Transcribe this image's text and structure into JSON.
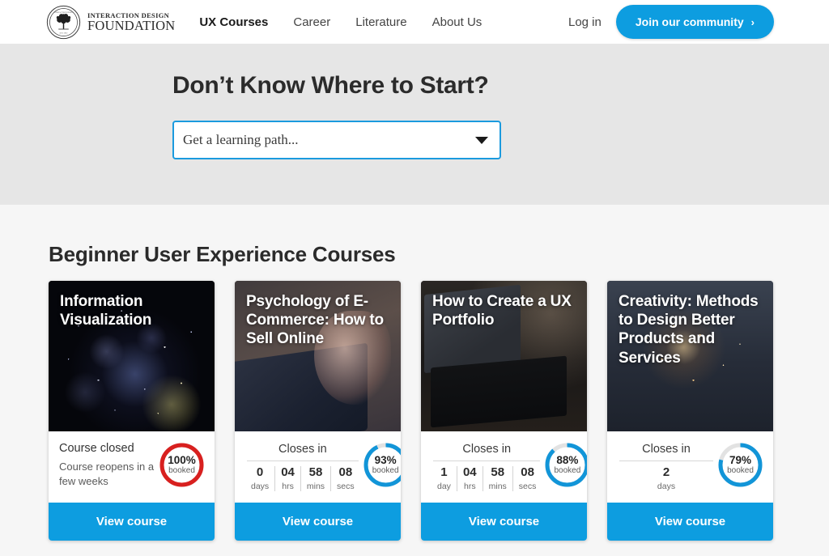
{
  "header": {
    "logo": {
      "line1": "INTERACTION DESIGN",
      "line2": "FOUNDATION",
      "icon": "tree-seal-logo"
    },
    "nav": [
      {
        "label": "UX Courses",
        "active": true
      },
      {
        "label": "Career",
        "active": false
      },
      {
        "label": "Literature",
        "active": false
      },
      {
        "label": "About Us",
        "active": false
      }
    ],
    "login_label": "Log in",
    "join_label": "Join our community",
    "join_chevron": "›",
    "accent_color": "#0d9de0"
  },
  "hero": {
    "heading": "Don’t Know Where to Start?",
    "select_value": "Get a learning path...",
    "select_placeholder": "Get a learning path...",
    "background_color": "#e6e6e6",
    "border_color": "#1b9ade"
  },
  "courses": {
    "section_title": "Beginner User Experience Courses",
    "view_course_label": "View course",
    "closes_in_label": "Closes in",
    "booked_label": "booked",
    "cards": [
      {
        "title": "Information Visualization",
        "art": "art-network",
        "state": "closed",
        "closed_title": "Course closed",
        "closed_sub": "Course reopens in a few weeks",
        "percent": 100,
        "percent_label": "100%",
        "ring_color": "#d8201f"
      },
      {
        "title": "Psychology of E-Commerce: How to Sell Online",
        "art": "art-phone",
        "state": "countdown",
        "units": [
          {
            "num": "0",
            "lbl": "days"
          },
          {
            "num": "04",
            "lbl": "hrs"
          },
          {
            "num": "58",
            "lbl": "mins"
          },
          {
            "num": "08",
            "lbl": "secs"
          }
        ],
        "percent": 93,
        "percent_label": "93%",
        "ring_color": "#1295d8"
      },
      {
        "title": "How to Create a UX Portfolio",
        "art": "art-laptop",
        "state": "countdown",
        "units": [
          {
            "num": "1",
            "lbl": "day"
          },
          {
            "num": "04",
            "lbl": "hrs"
          },
          {
            "num": "58",
            "lbl": "mins"
          },
          {
            "num": "08",
            "lbl": "secs"
          }
        ],
        "percent": 88,
        "percent_label": "88%",
        "ring_color": "#1295d8"
      },
      {
        "title": "Creativity: Methods to Design Better Products and Services",
        "art": "art-spark",
        "state": "countdown",
        "units": [
          {
            "num": "2",
            "lbl": "days"
          }
        ],
        "percent": 79,
        "percent_label": "79%",
        "ring_color": "#1295d8"
      }
    ]
  }
}
